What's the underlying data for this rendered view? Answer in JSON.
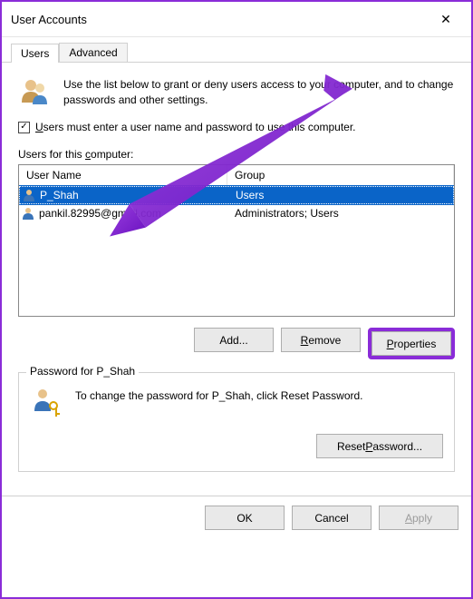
{
  "window": {
    "title": "User Accounts",
    "close_glyph": "✕"
  },
  "tabs": {
    "users": "Users",
    "advanced": "Advanced"
  },
  "intro_text": "Use the list below to grant or deny users access to your computer, and to change passwords and other settings.",
  "checkbox": {
    "checked_glyph": "✓",
    "prefix": "U",
    "rest": "sers must enter a user name and password to use this computer."
  },
  "list_label": {
    "prefix": "Users for this ",
    "u": "c",
    "suffix": "omputer:"
  },
  "columns": {
    "user": "User Name",
    "group": "Group"
  },
  "rows": [
    {
      "name": "P_Shah",
      "group": "Users",
      "selected": true
    },
    {
      "name": "pankil.82995@gmail.com",
      "group": "Administrators; Users",
      "selected": false
    }
  ],
  "buttons": {
    "add": "Add...",
    "remove_u": "R",
    "remove_rest": "emove",
    "properties_u": "P",
    "properties_rest": "roperties"
  },
  "password_group": {
    "title": "Password for P_Shah",
    "text": "To change the password for P_Shah, click Reset Password.",
    "reset_pre": "Reset ",
    "reset_u": "P",
    "reset_post": "assword..."
  },
  "footer": {
    "ok": "OK",
    "cancel": "Cancel",
    "apply_u": "A",
    "apply_rest": "pply"
  }
}
